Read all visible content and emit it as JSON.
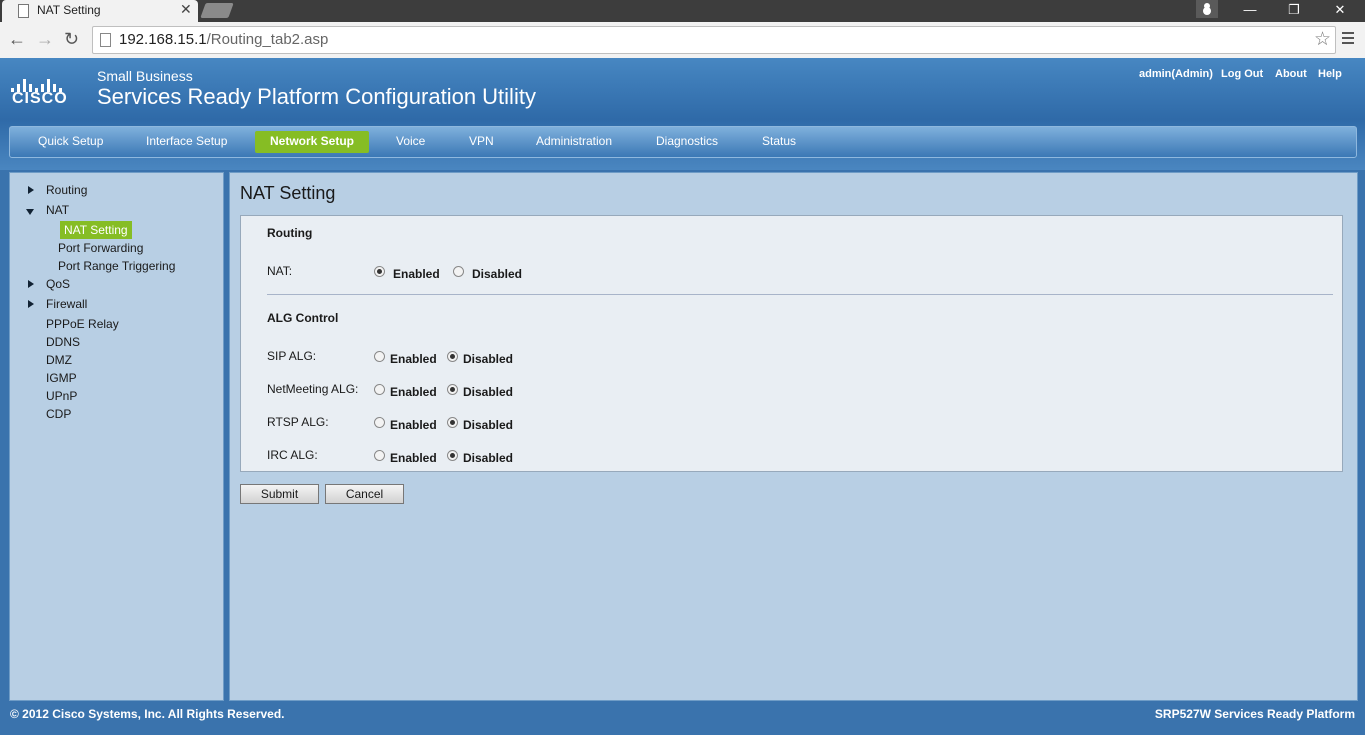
{
  "browser": {
    "tab_title": "NAT Setting",
    "url_host": "192.168.15.1",
    "url_path": "/Routing_tab2.asp"
  },
  "header": {
    "brand_small": "Small Business",
    "brand_title": "Services Ready Platform Configuration Utility",
    "user": "admin(Admin)",
    "logout": "Log Out",
    "about": "About",
    "help": "Help",
    "logo_text": "CISCO"
  },
  "nav": {
    "items": [
      "Quick Setup",
      "Interface Setup",
      "Network Setup",
      "Voice",
      "VPN",
      "Administration",
      "Diagnostics",
      "Status"
    ],
    "active": "Network Setup"
  },
  "sidebar": {
    "routing": "Routing",
    "nat": "NAT",
    "nat_setting": "NAT Setting",
    "port_forwarding": "Port Forwarding",
    "port_range_triggering": "Port Range Triggering",
    "qos": "QoS",
    "firewall": "Firewall",
    "pppoe_relay": "PPPoE Relay",
    "ddns": "DDNS",
    "dmz": "DMZ",
    "igmp": "IGMP",
    "upnp": "UPnP",
    "cdp": "CDP"
  },
  "main": {
    "title": "NAT Setting",
    "routing_section": "Routing",
    "nat_label": "NAT:",
    "alg_section": "ALG Control",
    "enabled": "Enabled",
    "disabled": "Disabled",
    "nat_value": "Enabled",
    "alg_rows": [
      {
        "label": "SIP ALG:",
        "value": "Disabled"
      },
      {
        "label": "NetMeeting ALG:",
        "value": "Disabled"
      },
      {
        "label": "RTSP ALG:",
        "value": "Disabled"
      },
      {
        "label": "IRC ALG:",
        "value": "Disabled"
      }
    ],
    "submit": "Submit",
    "cancel": "Cancel"
  },
  "footer": {
    "copyright": "© 2012 Cisco Systems, Inc. All Rights Reserved.",
    "product": "SRP527W Services Ready Platform"
  }
}
